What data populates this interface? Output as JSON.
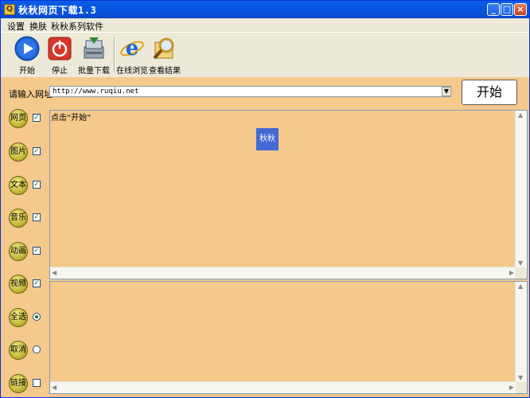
{
  "window": {
    "title": "秋秋网页下载1.3"
  },
  "titlebar_buttons": {
    "minimize": "_",
    "maximize": "□",
    "close": "×"
  },
  "menu": [
    "设置",
    "换肤",
    "秋秋系列软件"
  ],
  "toolbar": [
    {
      "label": "开始",
      "icon": "play-icon"
    },
    {
      "label": "停止",
      "icon": "stop-icon"
    },
    {
      "label": "批量下载",
      "icon": "batch-download-icon"
    },
    {
      "label": "在线浏览",
      "icon": "ie-browser-icon"
    },
    {
      "label": "查看结果",
      "icon": "magnifier-icon"
    }
  ],
  "url_bar": {
    "label": "请输入网址",
    "value": "http://www.ruqiu.net",
    "button": "开始"
  },
  "top_pane": {
    "hint": "点击“开始”",
    "badge": "秋秋"
  },
  "side_items": [
    {
      "label": "网页",
      "control": "checkbox",
      "checked": true
    },
    {
      "label": "图片",
      "control": "checkbox",
      "checked": true
    },
    {
      "label": "文本",
      "control": "checkbox",
      "checked": true
    },
    {
      "label": "音乐",
      "control": "checkbox",
      "checked": true
    },
    {
      "label": "动画",
      "control": "checkbox",
      "checked": true
    },
    {
      "label": "视频",
      "control": "checkbox",
      "checked": true
    },
    {
      "label": "全选",
      "control": "radio",
      "checked": true
    },
    {
      "label": "取消",
      "control": "radio",
      "checked": false
    },
    {
      "label": "链接",
      "control": "checkbox",
      "checked": false
    }
  ],
  "colors": {
    "pane_bg": "#f5c88c",
    "title_blue": "#0a5ee9",
    "badge_blue": "#4468d4"
  }
}
